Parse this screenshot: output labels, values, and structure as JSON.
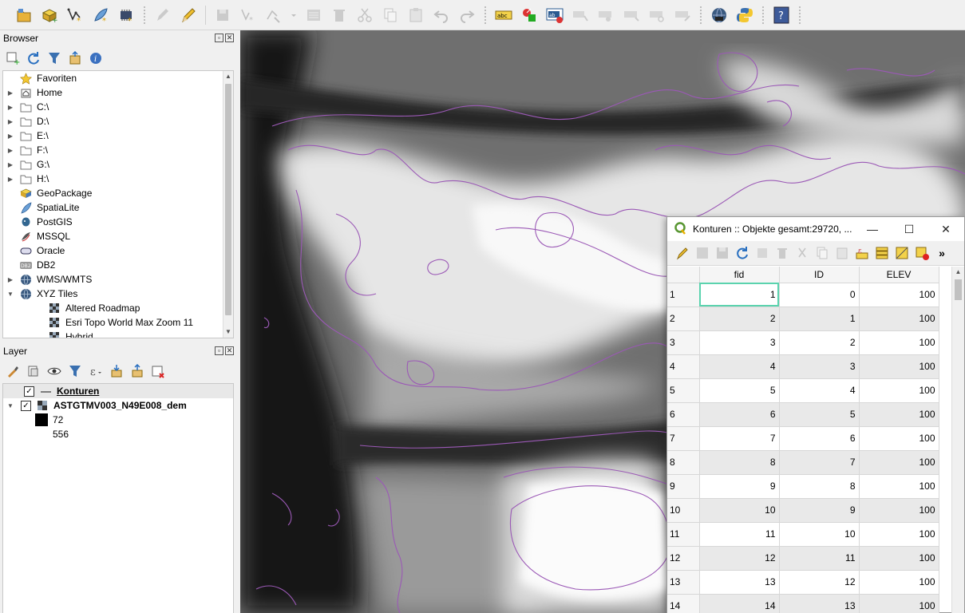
{
  "browser": {
    "title": "Browser",
    "items": [
      {
        "label": "Favoriten",
        "icon": "star-icon",
        "expandable": false
      },
      {
        "label": "Home",
        "icon": "home-folder-icon",
        "expandable": true
      },
      {
        "label": "C:\\",
        "icon": "folder-icon",
        "expandable": true
      },
      {
        "label": "D:\\",
        "icon": "folder-icon",
        "expandable": true
      },
      {
        "label": "E:\\",
        "icon": "folder-icon",
        "expandable": true
      },
      {
        "label": "F:\\",
        "icon": "folder-icon",
        "expandable": true
      },
      {
        "label": "G:\\",
        "icon": "folder-icon",
        "expandable": true
      },
      {
        "label": "H:\\",
        "icon": "folder-icon",
        "expandable": true
      },
      {
        "label": "GeoPackage",
        "icon": "geopackage-icon",
        "expandable": false
      },
      {
        "label": "SpatiaLite",
        "icon": "spatialite-icon",
        "expandable": false
      },
      {
        "label": "PostGIS",
        "icon": "postgis-icon",
        "expandable": false
      },
      {
        "label": "MSSQL",
        "icon": "mssql-icon",
        "expandable": false
      },
      {
        "label": "Oracle",
        "icon": "oracle-icon",
        "expandable": false
      },
      {
        "label": "DB2",
        "icon": "db2-icon",
        "expandable": false
      },
      {
        "label": "WMS/WMTS",
        "icon": "globe-icon",
        "expandable": true
      },
      {
        "label": "XYZ Tiles",
        "icon": "globe-icon",
        "expandable": true,
        "expanded": true
      },
      {
        "label": "Altered Roadmap",
        "icon": "xyz-tile-icon",
        "child": true
      },
      {
        "label": "Esri Topo World Max Zoom 11",
        "icon": "xyz-tile-icon",
        "child": true
      },
      {
        "label": "Hybrid",
        "icon": "xyz-tile-icon",
        "child": true
      }
    ]
  },
  "layers": {
    "title": "Layer",
    "items": [
      {
        "label": "Konturen",
        "checked": true,
        "bold": true,
        "underline": true,
        "icon": "line-layer-icon"
      },
      {
        "label": "ASTGTMV003_N49E008_dem",
        "checked": true,
        "bold": true,
        "icon": "raster-layer-icon",
        "expanded": true
      }
    ],
    "legend": [
      {
        "label": "72",
        "color": "#000000"
      },
      {
        "label": "556",
        "color": "#ffffff"
      }
    ]
  },
  "attribute_table": {
    "title": "Konturen :: Objekte gesamt:29720, ...",
    "columns": [
      "fid",
      "ID",
      "ELEV"
    ],
    "rows": [
      [
        "1",
        "1",
        "0",
        "100"
      ],
      [
        "2",
        "2",
        "1",
        "100"
      ],
      [
        "3",
        "3",
        "2",
        "100"
      ],
      [
        "4",
        "4",
        "3",
        "100"
      ],
      [
        "5",
        "5",
        "4",
        "100"
      ],
      [
        "6",
        "6",
        "5",
        "100"
      ],
      [
        "7",
        "7",
        "6",
        "100"
      ],
      [
        "8",
        "8",
        "7",
        "100"
      ],
      [
        "9",
        "9",
        "8",
        "100"
      ],
      [
        "10",
        "10",
        "9",
        "100"
      ],
      [
        "11",
        "11",
        "10",
        "100"
      ],
      [
        "12",
        "12",
        "11",
        "100"
      ],
      [
        "13",
        "13",
        "12",
        "100"
      ],
      [
        "14",
        "14",
        "13",
        "100"
      ]
    ],
    "more_tools": "»"
  },
  "colors": {
    "contour": "#9b59b6",
    "selection": "#5bd3ae",
    "help_button": "#3d5a99"
  }
}
